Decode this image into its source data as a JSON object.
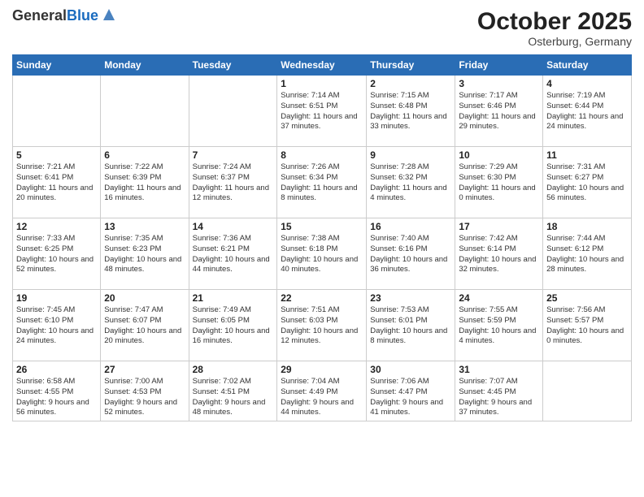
{
  "header": {
    "logo_general": "General",
    "logo_blue": "Blue",
    "month": "October 2025",
    "location": "Osterburg, Germany"
  },
  "days_of_week": [
    "Sunday",
    "Monday",
    "Tuesday",
    "Wednesday",
    "Thursday",
    "Friday",
    "Saturday"
  ],
  "weeks": [
    [
      {
        "day": "",
        "info": ""
      },
      {
        "day": "",
        "info": ""
      },
      {
        "day": "",
        "info": ""
      },
      {
        "day": "1",
        "info": "Sunrise: 7:14 AM\nSunset: 6:51 PM\nDaylight: 11 hours\nand 37 minutes."
      },
      {
        "day": "2",
        "info": "Sunrise: 7:15 AM\nSunset: 6:48 PM\nDaylight: 11 hours\nand 33 minutes."
      },
      {
        "day": "3",
        "info": "Sunrise: 7:17 AM\nSunset: 6:46 PM\nDaylight: 11 hours\nand 29 minutes."
      },
      {
        "day": "4",
        "info": "Sunrise: 7:19 AM\nSunset: 6:44 PM\nDaylight: 11 hours\nand 24 minutes."
      }
    ],
    [
      {
        "day": "5",
        "info": "Sunrise: 7:21 AM\nSunset: 6:41 PM\nDaylight: 11 hours\nand 20 minutes."
      },
      {
        "day": "6",
        "info": "Sunrise: 7:22 AM\nSunset: 6:39 PM\nDaylight: 11 hours\nand 16 minutes."
      },
      {
        "day": "7",
        "info": "Sunrise: 7:24 AM\nSunset: 6:37 PM\nDaylight: 11 hours\nand 12 minutes."
      },
      {
        "day": "8",
        "info": "Sunrise: 7:26 AM\nSunset: 6:34 PM\nDaylight: 11 hours\nand 8 minutes."
      },
      {
        "day": "9",
        "info": "Sunrise: 7:28 AM\nSunset: 6:32 PM\nDaylight: 11 hours\nand 4 minutes."
      },
      {
        "day": "10",
        "info": "Sunrise: 7:29 AM\nSunset: 6:30 PM\nDaylight: 11 hours\nand 0 minutes."
      },
      {
        "day": "11",
        "info": "Sunrise: 7:31 AM\nSunset: 6:27 PM\nDaylight: 10 hours\nand 56 minutes."
      }
    ],
    [
      {
        "day": "12",
        "info": "Sunrise: 7:33 AM\nSunset: 6:25 PM\nDaylight: 10 hours\nand 52 minutes."
      },
      {
        "day": "13",
        "info": "Sunrise: 7:35 AM\nSunset: 6:23 PM\nDaylight: 10 hours\nand 48 minutes."
      },
      {
        "day": "14",
        "info": "Sunrise: 7:36 AM\nSunset: 6:21 PM\nDaylight: 10 hours\nand 44 minutes."
      },
      {
        "day": "15",
        "info": "Sunrise: 7:38 AM\nSunset: 6:18 PM\nDaylight: 10 hours\nand 40 minutes."
      },
      {
        "day": "16",
        "info": "Sunrise: 7:40 AM\nSunset: 6:16 PM\nDaylight: 10 hours\nand 36 minutes."
      },
      {
        "day": "17",
        "info": "Sunrise: 7:42 AM\nSunset: 6:14 PM\nDaylight: 10 hours\nand 32 minutes."
      },
      {
        "day": "18",
        "info": "Sunrise: 7:44 AM\nSunset: 6:12 PM\nDaylight: 10 hours\nand 28 minutes."
      }
    ],
    [
      {
        "day": "19",
        "info": "Sunrise: 7:45 AM\nSunset: 6:10 PM\nDaylight: 10 hours\nand 24 minutes."
      },
      {
        "day": "20",
        "info": "Sunrise: 7:47 AM\nSunset: 6:07 PM\nDaylight: 10 hours\nand 20 minutes."
      },
      {
        "day": "21",
        "info": "Sunrise: 7:49 AM\nSunset: 6:05 PM\nDaylight: 10 hours\nand 16 minutes."
      },
      {
        "day": "22",
        "info": "Sunrise: 7:51 AM\nSunset: 6:03 PM\nDaylight: 10 hours\nand 12 minutes."
      },
      {
        "day": "23",
        "info": "Sunrise: 7:53 AM\nSunset: 6:01 PM\nDaylight: 10 hours\nand 8 minutes."
      },
      {
        "day": "24",
        "info": "Sunrise: 7:55 AM\nSunset: 5:59 PM\nDaylight: 10 hours\nand 4 minutes."
      },
      {
        "day": "25",
        "info": "Sunrise: 7:56 AM\nSunset: 5:57 PM\nDaylight: 10 hours\nand 0 minutes."
      }
    ],
    [
      {
        "day": "26",
        "info": "Sunrise: 6:58 AM\nSunset: 4:55 PM\nDaylight: 9 hours\nand 56 minutes."
      },
      {
        "day": "27",
        "info": "Sunrise: 7:00 AM\nSunset: 4:53 PM\nDaylight: 9 hours\nand 52 minutes."
      },
      {
        "day": "28",
        "info": "Sunrise: 7:02 AM\nSunset: 4:51 PM\nDaylight: 9 hours\nand 48 minutes."
      },
      {
        "day": "29",
        "info": "Sunrise: 7:04 AM\nSunset: 4:49 PM\nDaylight: 9 hours\nand 44 minutes."
      },
      {
        "day": "30",
        "info": "Sunrise: 7:06 AM\nSunset: 4:47 PM\nDaylight: 9 hours\nand 41 minutes."
      },
      {
        "day": "31",
        "info": "Sunrise: 7:07 AM\nSunset: 4:45 PM\nDaylight: 9 hours\nand 37 minutes."
      },
      {
        "day": "",
        "info": ""
      }
    ]
  ]
}
